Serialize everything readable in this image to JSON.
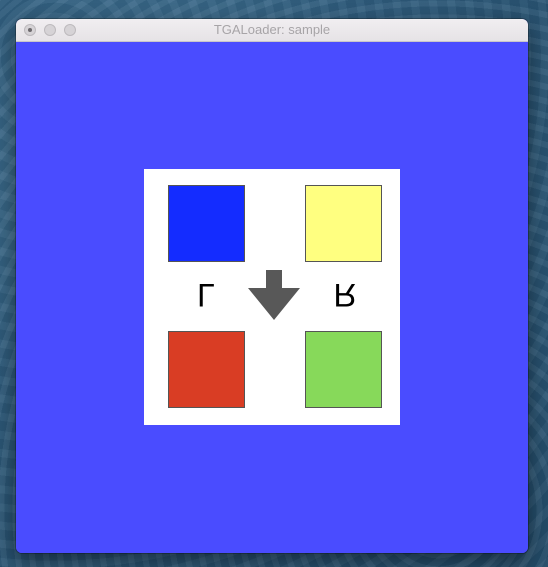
{
  "window": {
    "title": "TGALoader: sample",
    "background_color": "#4a4cff"
  },
  "titlebar_buttons": [
    {
      "name": "close-button",
      "icon": "dot-icon"
    },
    {
      "name": "minimize-button",
      "icon": "none"
    },
    {
      "name": "zoom-button",
      "icon": "none"
    }
  ],
  "texture": {
    "background_color": "#ffffff",
    "squares": {
      "top_left": "#142cff",
      "top_right": "#ffff80",
      "bottom_left": "#d93d24",
      "bottom_right": "#87d95a"
    },
    "left_letter": "L",
    "right_letter": "R",
    "arrow_icon": "arrow-down-icon",
    "arrow_color": "#585858"
  }
}
